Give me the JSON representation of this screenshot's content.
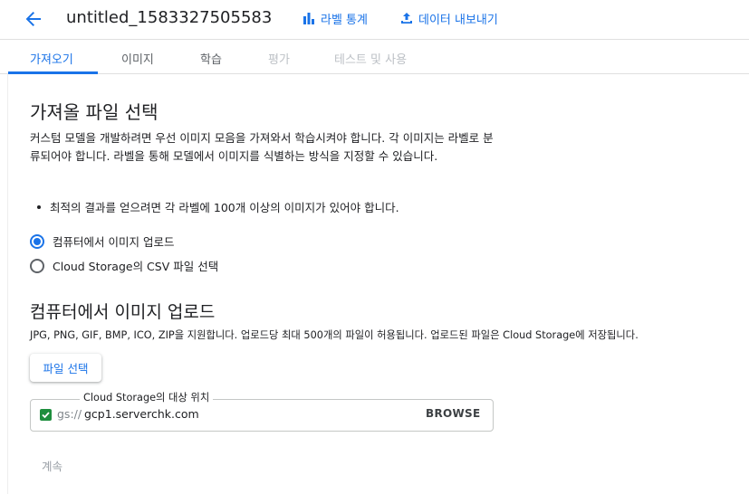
{
  "header": {
    "title": "untitled_1583327505583",
    "stats_label": "라벨 통계",
    "export_label": "데이터 내보내기"
  },
  "tabs": [
    {
      "label": "가져오기",
      "state": "active"
    },
    {
      "label": "이미지",
      "state": "normal"
    },
    {
      "label": "학습",
      "state": "normal"
    },
    {
      "label": "평가",
      "state": "disabled"
    },
    {
      "label": "테스트 및 사용",
      "state": "disabled"
    }
  ],
  "import": {
    "heading": "가져올 파일 선택",
    "description": "커스텀 모델을 개발하려면 우선 이미지 모음을 가져와서 학습시켜야 합니다. 각 이미지는 라벨로 분류되어야 합니다. 라벨을 통해 모델에서 이미지를 식별하는 방식을 지정할 수 있습니다.",
    "tip": "최적의 결과를 얻으려면 각 라벨에 100개 이상의 이미지가 있어야 합니다.",
    "options": [
      {
        "label": "컴퓨터에서 이미지 업로드",
        "selected": true
      },
      {
        "label": "Cloud Storage의 CSV 파일 선택",
        "selected": false
      }
    ]
  },
  "upload": {
    "heading": "컴퓨터에서 이미지 업로드",
    "info": "JPG, PNG, GIF, BMP, ICO, ZIP을 지원합니다. 업로드당 최대 500개의 파일이 허용됩니다. 업로드된 파일은 Cloud Storage에 저장됩니다.",
    "select_files_label": "파일 선택",
    "destination": {
      "label": "Cloud Storage의 대상 위치",
      "prefix": "gs://",
      "value": "gcp1.serverchk.com",
      "browse_label": "BROWSE"
    }
  },
  "continue_label": "계속",
  "colors": {
    "accent": "#1a73e8",
    "success": "#1e8e3e",
    "disabled": "#bdc1c6"
  },
  "icons": [
    "arrow-back-icon",
    "bar-chart-icon",
    "upload-icon",
    "check-icon"
  ]
}
